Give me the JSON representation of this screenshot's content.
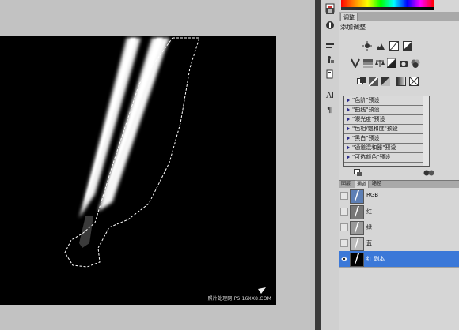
{
  "adjustments": {
    "tab": "调整",
    "heading": "添加调整",
    "presets": [
      "\"色阶\"预设",
      "\"曲线\"预设",
      "\"曝光度\"预设",
      "\"色相/饱和度\"预设",
      "\"黑白\"预设",
      "\"通道混和器\"预设",
      "\"可选颜色\"预设"
    ]
  },
  "channels": {
    "tabs": [
      "图层",
      "通道",
      "路径"
    ],
    "rows": [
      {
        "label": "RGB"
      },
      {
        "label": "红"
      },
      {
        "label": "绿"
      },
      {
        "label": "蓝"
      },
      {
        "label": "红 副本"
      }
    ]
  },
  "canvas": {
    "watermark": "照片处理网 PS.16XX8.COM"
  },
  "colors": {
    "selection": "#3b78d8",
    "panel_bg": "#d6d6d6",
    "canvas_bg": "#000000"
  }
}
